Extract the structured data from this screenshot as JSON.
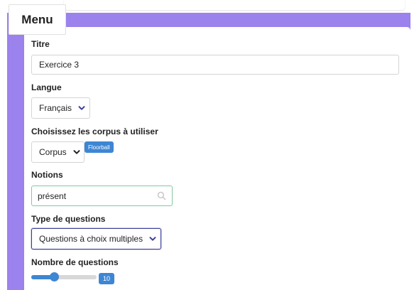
{
  "menu": {
    "label": "Menu"
  },
  "form": {
    "title": {
      "label": "Titre",
      "value": "Exercice 3"
    },
    "language": {
      "label": "Langue",
      "selected": "Français"
    },
    "corpus": {
      "label": "Choisissez les corpus à utiliser",
      "button_label": "Corpus",
      "selected_tags": [
        "Floorball"
      ]
    },
    "notions": {
      "label": "Notions",
      "value": "présent",
      "icon": "search-icon"
    },
    "question_type": {
      "label": "Type de questions",
      "selected": "Questions à choix multiples"
    },
    "question_count": {
      "label": "Nombre de questions",
      "value": "10",
      "fraction": 0.35
    }
  },
  "colors": {
    "accent_purple": "#9b82ec",
    "accent_blue": "#3d86d4",
    "valid_green": "#7fc9a0",
    "focus_navy": "#3b3f99"
  }
}
